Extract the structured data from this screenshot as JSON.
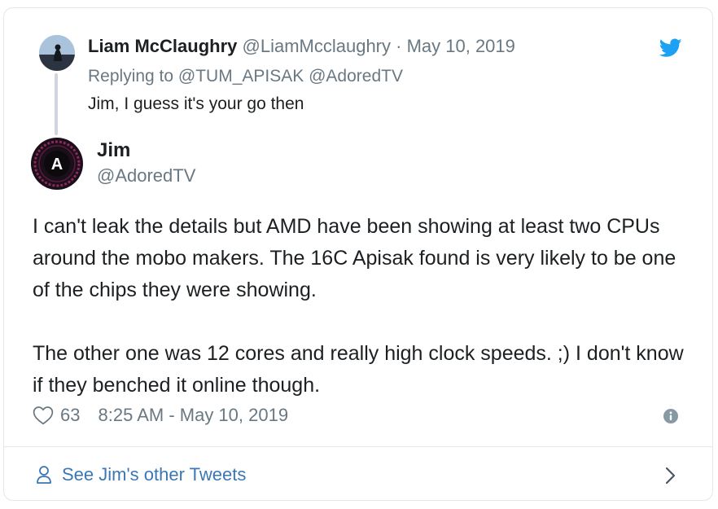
{
  "parent": {
    "name": "Liam McClaughry",
    "handle": "@LiamMcclaughry",
    "separator": "·",
    "date": "May 10, 2019",
    "replying_to": "Replying to @TUM_APISAK @AdoredTV",
    "text": "Jim, I guess it's your go then"
  },
  "tweet": {
    "avatar_letter": "A",
    "name": "Jim",
    "handle": "@AdoredTV",
    "paragraphs": [
      "I can't leak the details but AMD have been showing at least two CPUs around the mobo makers. The 16C Apisak found is very likely to be one of the chips they were showing.",
      "The other one was 12 cores and really high clock speeds. ;)  I don't know if they benched it online though."
    ],
    "likes": "63",
    "timestamp": "8:25 AM - May 10, 2019"
  },
  "footer": {
    "link_label": "See Jim's other Tweets"
  },
  "colors": {
    "brand": "#1da1f2",
    "link": "#3b77b4",
    "muted": "#697882",
    "border": "#e1e8ed"
  },
  "icons": [
    "twitter-bird-icon",
    "heart-icon",
    "info-icon",
    "person-icon",
    "chevron-right-icon"
  ]
}
